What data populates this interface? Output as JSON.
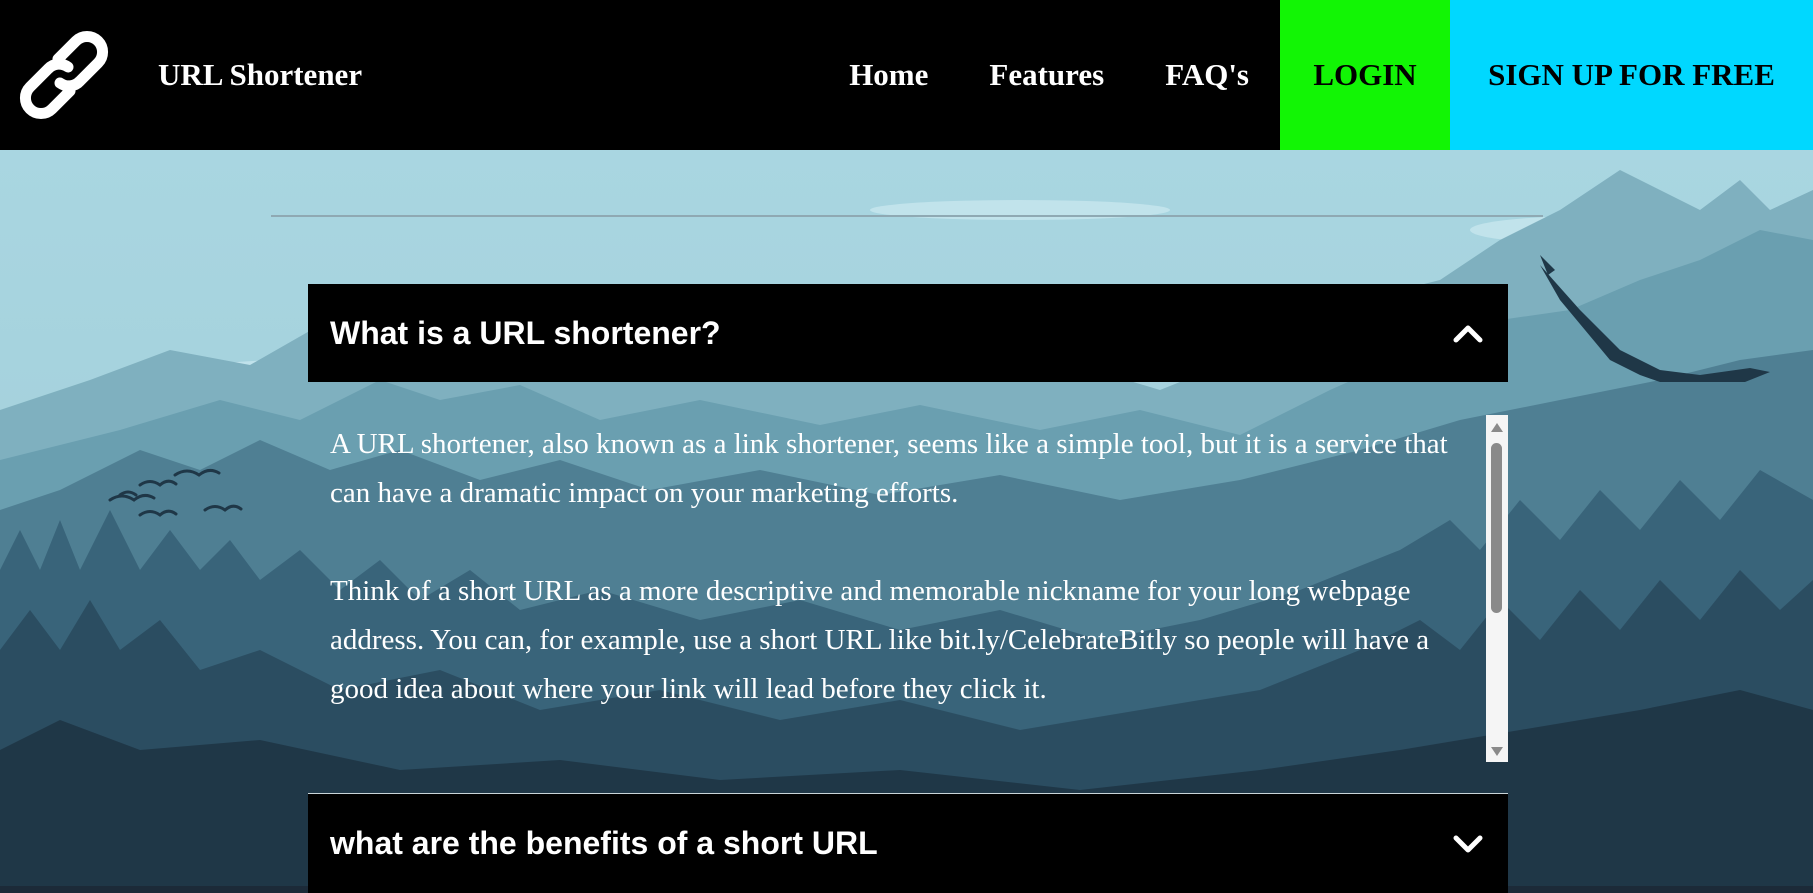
{
  "header": {
    "brand": "URL Shortener",
    "logo_icon": "chain-link-icon",
    "nav": [
      "Home",
      "Features",
      "FAQ's"
    ],
    "login_label": "LOGIN",
    "signup_label": "SIGN UP FOR FREE"
  },
  "colors": {
    "header_bg": "#000000",
    "login_bg": "#12f505",
    "signup_bg": "#00d8ff",
    "sky": "#a6d3de"
  },
  "faq": {
    "items": [
      {
        "question": "What is a URL shortener?",
        "expanded": true,
        "icon": "chevron-up-icon",
        "answer": [
          "A URL shortener, also known as a link shortener, seems like a simple tool, but it is a service that can have a dramatic impact on your marketing efforts.",
          "Think of a short URL as a more descriptive and memorable nickname for your long webpage address. You can, for example, use a short URL like bit.ly/CelebrateBitly so people will have a good idea about where your link will lead before they click it."
        ]
      },
      {
        "question": "what are the benefits of a short URL",
        "expanded": false,
        "icon": "chevron-down-icon"
      }
    ]
  }
}
